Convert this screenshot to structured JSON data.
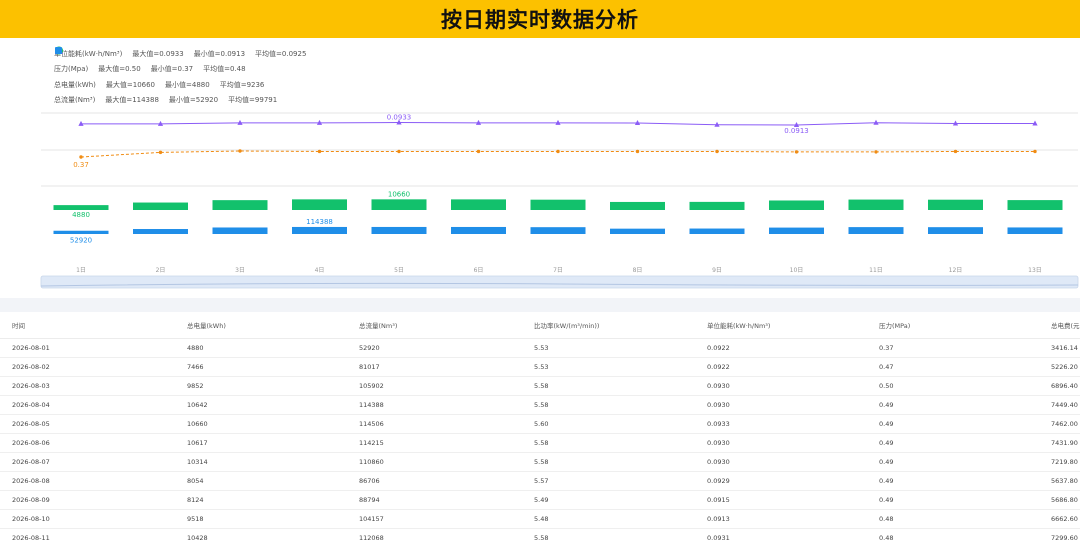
{
  "title": "按日期实时数据分析",
  "legend": [
    {
      "icon": "triangle-icon",
      "color": "#8b5cf6",
      "name": "单位能耗(kW·h/Nm³)",
      "max": "最大值=0.0933",
      "min": "最小值=0.0913",
      "avg": "平均值=0.0925"
    },
    {
      "icon": "diamond-icon",
      "color": "#f08c13",
      "name": "压力(Mpa)",
      "max": "最大值=0.50",
      "min": "最小值=0.37",
      "avg": "平均值=0.48"
    },
    {
      "icon": "circle-icon",
      "color": "#12c16c",
      "name": "总电量(kWh)",
      "max": "最大值=10660",
      "min": "最小值=4880",
      "avg": "平均值=9236"
    },
    {
      "icon": "square-icon",
      "color": "#1f8ee8",
      "name": "总流量(Nm³)",
      "max": "最大值=114388",
      "min": "最小值=52920",
      "avg": "平均值=99791"
    }
  ],
  "chart_data": {
    "type": "bar",
    "categories": [
      "1日",
      "2日",
      "3日",
      "4日",
      "5日",
      "6日",
      "7日",
      "8日",
      "9日",
      "10日",
      "11日",
      "12日",
      "13日"
    ],
    "series": [
      {
        "name": "单位能耗(kW·h/Nm³)",
        "type": "line",
        "color": "#8b5cf6",
        "values": [
          0.0922,
          0.0922,
          0.093,
          0.093,
          0.0933,
          0.093,
          0.093,
          0.0929,
          0.0915,
          0.0913,
          0.0931,
          0.0925,
          0.0925
        ]
      },
      {
        "name": "压力(Mpa)",
        "type": "line",
        "color": "#f08c13",
        "values": [
          0.37,
          0.47,
          0.5,
          0.49,
          0.49,
          0.49,
          0.49,
          0.49,
          0.49,
          0.48,
          0.48,
          0.49,
          0.49
        ]
      },
      {
        "name": "总电量(kWh)",
        "type": "bar",
        "color": "#12c16c",
        "values": [
          4880,
          7466,
          9852,
          10642,
          10660,
          10617,
          10314,
          8054,
          8124,
          9518,
          10428,
          10300,
          9900
        ]
      },
      {
        "name": "总流量(Nm³)",
        "type": "bar",
        "color": "#1f8ee8",
        "values": [
          52920,
          81017,
          105902,
          114388,
          114506,
          114215,
          110860,
          86706,
          88794,
          104157,
          112068,
          111000,
          106500
        ]
      }
    ],
    "annotations": [
      {
        "series": 0,
        "index": 4,
        "text": "0.0933"
      },
      {
        "series": 0,
        "index": 9,
        "text": "0.0913"
      },
      {
        "series": 1,
        "index": 0,
        "text": "0.37"
      },
      {
        "series": 2,
        "index": 4,
        "text": "10660"
      },
      {
        "series": 2,
        "index": 0,
        "text": "4880"
      },
      {
        "series": 3,
        "index": 3,
        "text": "114388"
      },
      {
        "series": 3,
        "index": 0,
        "text": "52920"
      }
    ],
    "grid": true,
    "legend_position": "top-left"
  },
  "table": {
    "headers": [
      "时间",
      "总电量(kWh)",
      "总流量(Nm³)",
      "比功率(kW/(m³/min))",
      "单位能耗(kW·h/Nm³)",
      "压力(MPa)",
      "总电费(元)"
    ],
    "rows": [
      [
        "2026-08-01",
        "4880",
        "52920",
        "5.53",
        "0.0922",
        "0.37",
        "3416.14"
      ],
      [
        "2026-08-02",
        "7466",
        "81017",
        "5.53",
        "0.0922",
        "0.47",
        "5226.20"
      ],
      [
        "2026-08-03",
        "9852",
        "105902",
        "5.58",
        "0.0930",
        "0.50",
        "6896.40"
      ],
      [
        "2026-08-04",
        "10642",
        "114388",
        "5.58",
        "0.0930",
        "0.49",
        "7449.40"
      ],
      [
        "2026-08-05",
        "10660",
        "114506",
        "5.60",
        "0.0933",
        "0.49",
        "7462.00"
      ],
      [
        "2026-08-06",
        "10617",
        "114215",
        "5.58",
        "0.0930",
        "0.49",
        "7431.90"
      ],
      [
        "2026-08-07",
        "10314",
        "110860",
        "5.58",
        "0.0930",
        "0.49",
        "7219.80"
      ],
      [
        "2026-08-08",
        "8054",
        "86706",
        "5.57",
        "0.0929",
        "0.49",
        "5637.80"
      ],
      [
        "2026-08-09",
        "8124",
        "88794",
        "5.49",
        "0.0915",
        "0.49",
        "5686.80"
      ],
      [
        "2026-08-10",
        "9518",
        "104157",
        "5.48",
        "0.0913",
        "0.48",
        "6662.60"
      ],
      [
        "2026-08-11",
        "10428",
        "112068",
        "5.58",
        "0.0931",
        "0.48",
        "7299.60"
      ]
    ]
  }
}
